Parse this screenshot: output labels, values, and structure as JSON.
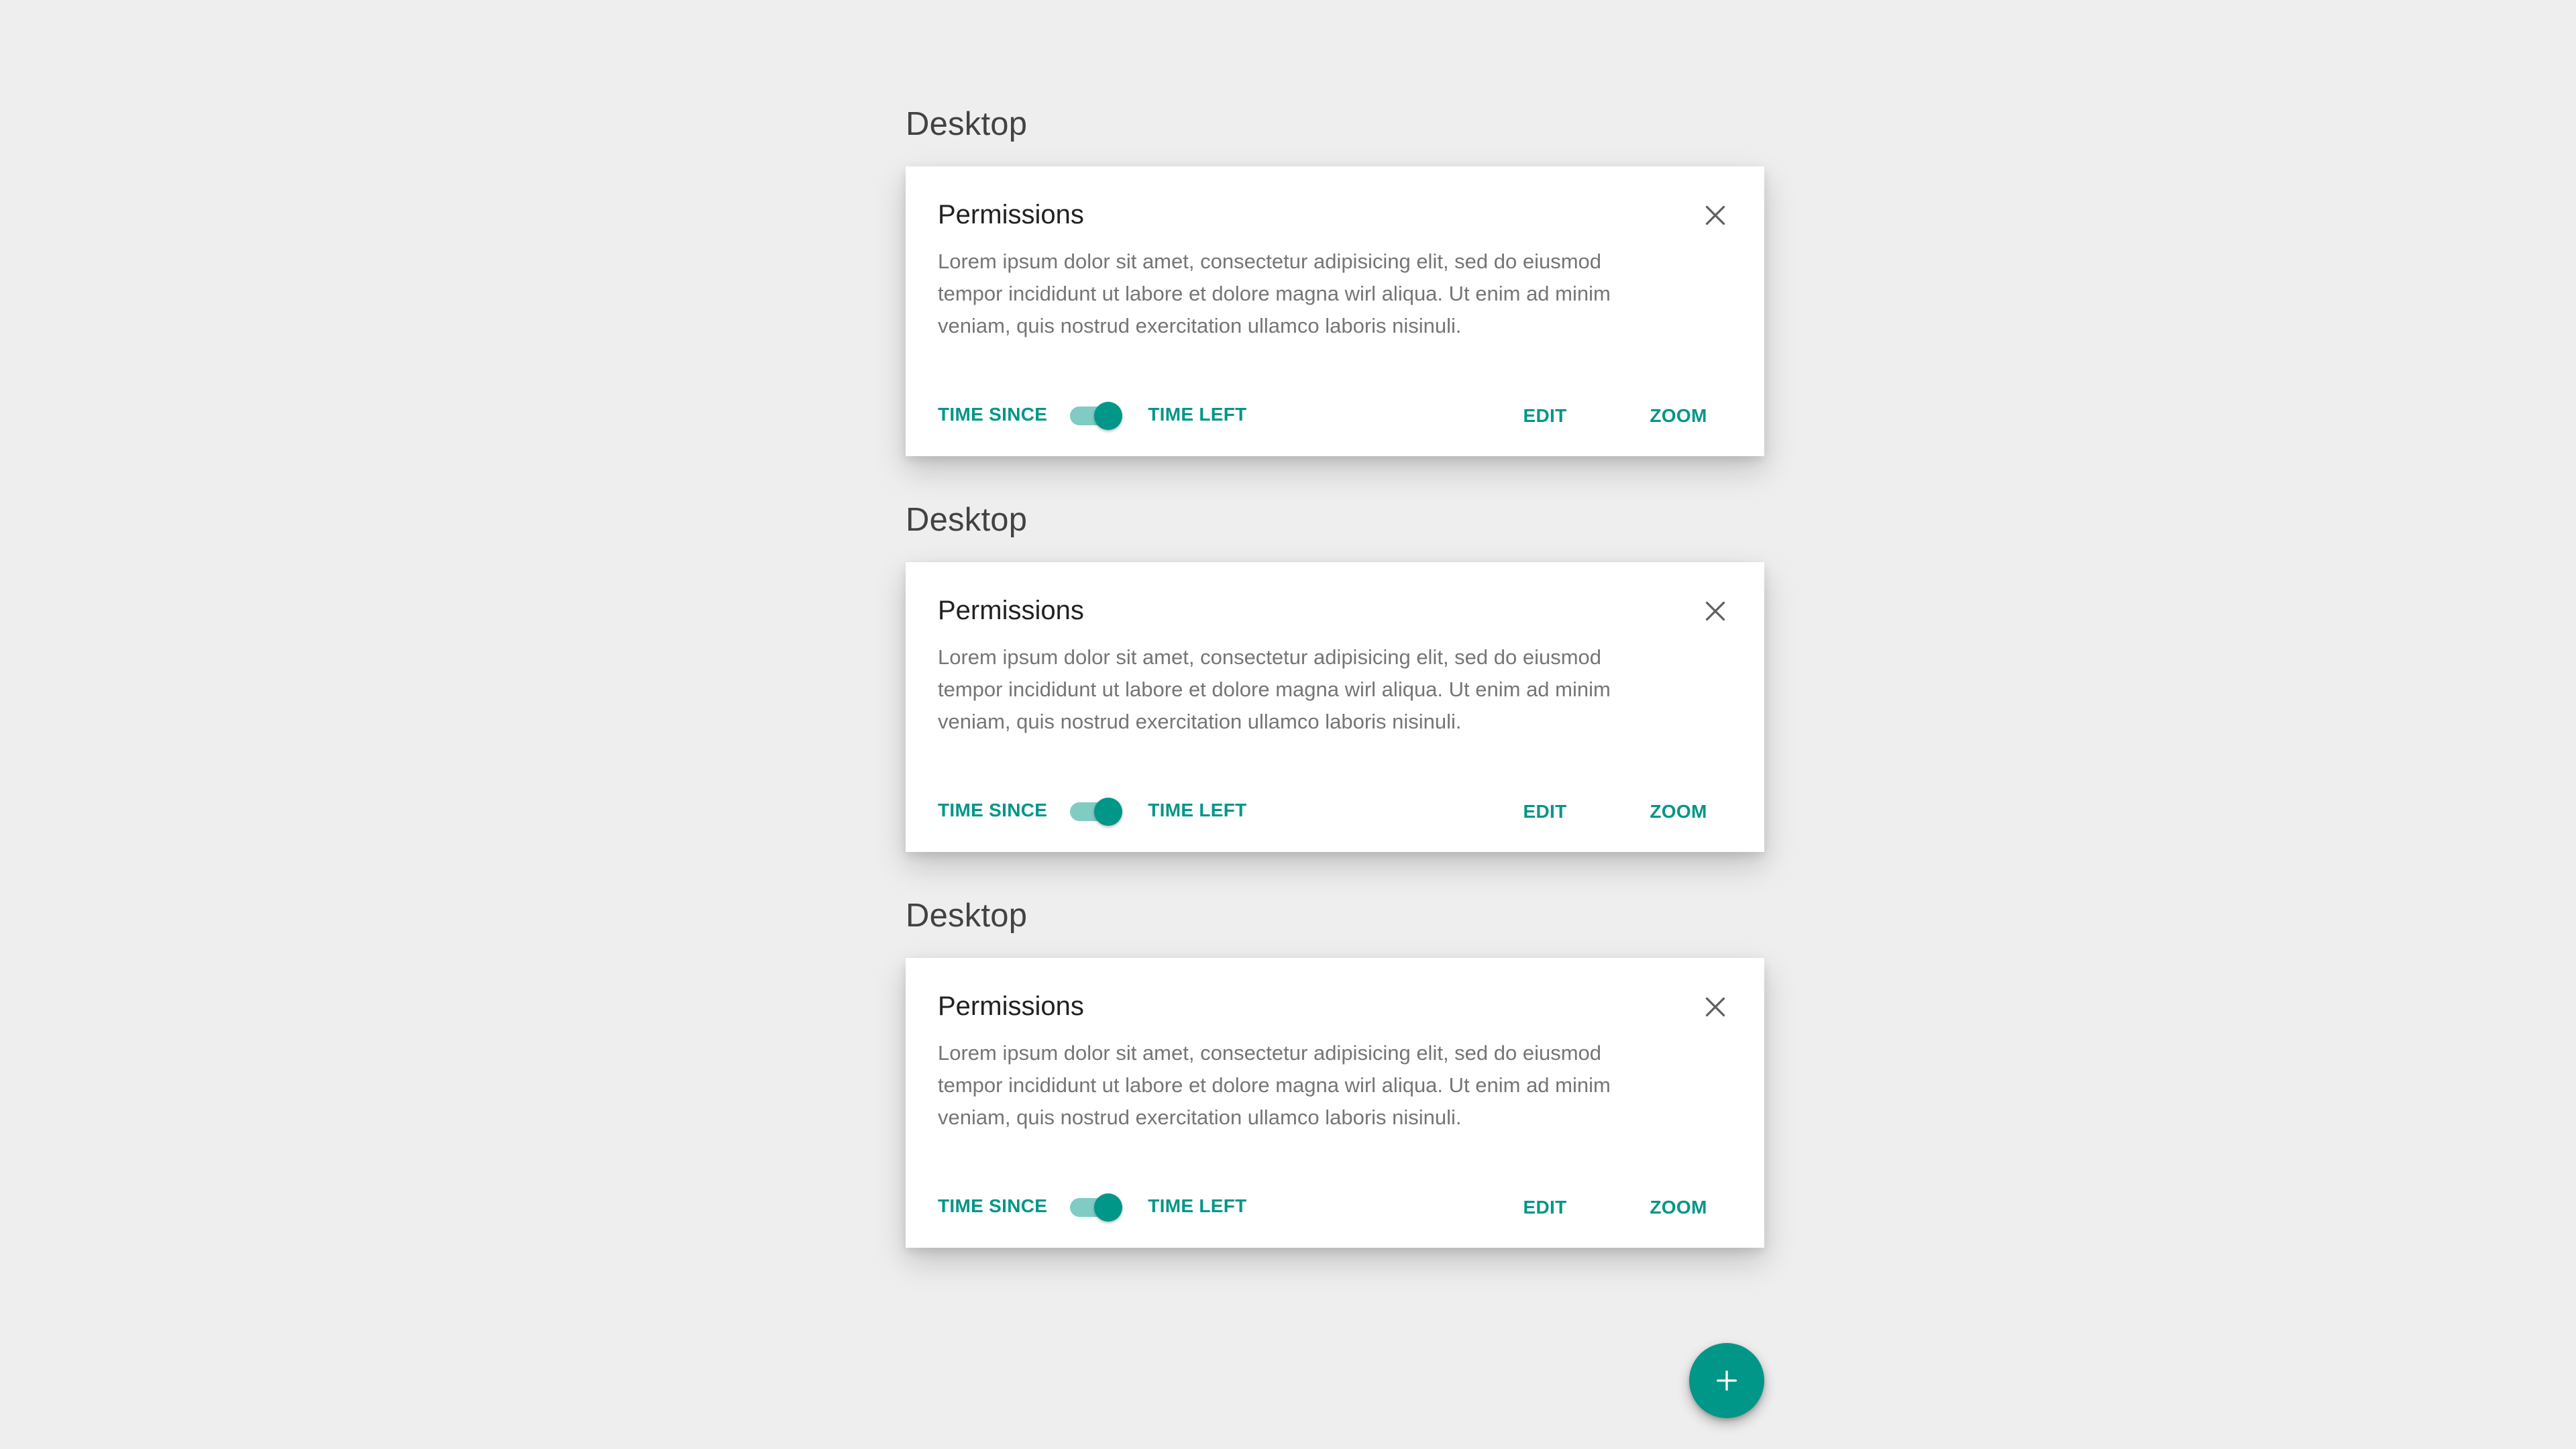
{
  "sections": [
    {
      "heading": "Desktop",
      "card": {
        "title": "Permissions",
        "body": "Lorem ipsum dolor sit amet, consectetur adipisicing elit, sed do eiusmod tempor incididunt ut labore et dolore magna wirl aliqua. Ut enim ad minim veniam, quis nostrud exercitation ullamco laboris nisinuli.",
        "toggle_left_label": "TIME SINCE",
        "toggle_right_label": "TIME LEFT",
        "toggle_on": true,
        "edit_label": "EDIT",
        "zoom_label": "ZOOM",
        "close_icon": "close-icon"
      }
    },
    {
      "heading": "Desktop",
      "card": {
        "title": "Permissions",
        "body": "Lorem ipsum dolor sit amet, consectetur adipisicing elit, sed do eiusmod tempor incididunt ut labore et dolore magna wirl aliqua. Ut enim ad minim veniam, quis nostrud exercitation ullamco laboris nisinuli.",
        "toggle_left_label": "TIME SINCE",
        "toggle_right_label": "TIME LEFT",
        "toggle_on": true,
        "edit_label": "EDIT",
        "zoom_label": "ZOOM",
        "close_icon": "close-icon"
      }
    },
    {
      "heading": "Desktop",
      "card": {
        "title": "Permissions",
        "body": "Lorem ipsum dolor sit amet, consectetur adipisicing elit, sed do eiusmod tempor incididunt ut labore et dolore magna wirl aliqua. Ut enim ad minim veniam, quis nostrud exercitation ullamco laboris nisinuli.",
        "toggle_left_label": "TIME SINCE",
        "toggle_right_label": "TIME LEFT",
        "toggle_on": true,
        "edit_label": "EDIT",
        "zoom_label": "ZOOM",
        "close_icon": "close-icon"
      }
    }
  ],
  "fab": {
    "icon": "plus-icon"
  },
  "colors": {
    "background": "#eeeeee",
    "accent": "#009688",
    "accent_light": "#80cbc4",
    "card": "#ffffff",
    "heading_text": "#424242",
    "body_text": "#757575"
  }
}
